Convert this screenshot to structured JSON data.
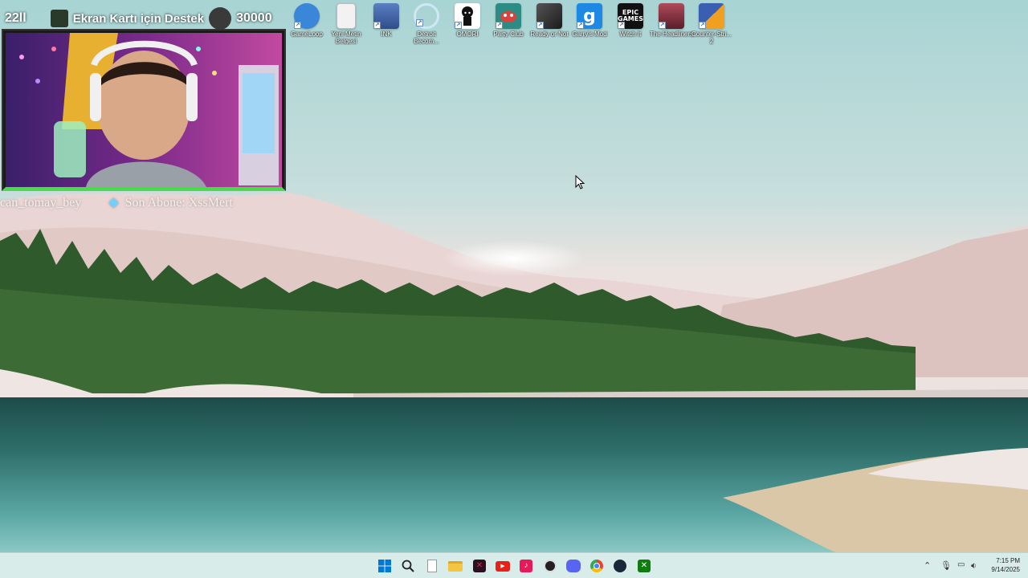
{
  "overlay": {
    "viewer_count": "22ll",
    "banner_text": "Ekran Kartı için Destek",
    "goal": "30000",
    "ticker_left": "can_tomay_bey",
    "ticker_right": "Son Abone: XssMert"
  },
  "desktop_icons": [
    {
      "label": "GameLoop",
      "icon": "gameloop-icon",
      "color": "#3a86d8"
    },
    {
      "label": "Yeni Metin Belgesi",
      "icon": "text-document-icon",
      "color": "#f2f2f2"
    },
    {
      "label": "INK",
      "icon": "ink-game-icon",
      "color": "#2f4d8a"
    },
    {
      "label": "Detroit Becom...",
      "icon": "detroit-icon",
      "color": "#e8f4fb"
    },
    {
      "label": "OMORI",
      "icon": "omori-icon",
      "color": "#ffffff"
    },
    {
      "label": "Party Club",
      "icon": "party-club-icon",
      "color": "#2c8c83"
    },
    {
      "label": "Ready or Not",
      "icon": "ready-or-not-icon",
      "color": "#2b2b2b"
    },
    {
      "label": "Garry's Mod",
      "icon": "garrys-mod-icon",
      "color": "#1e88e5"
    },
    {
      "label": "Witch It",
      "icon": "epic-games-icon",
      "color": "#111111"
    },
    {
      "label": "The Headliners",
      "icon": "headliners-icon",
      "color": "#7a2a3a"
    },
    {
      "label": "Counter-Stri... 2",
      "icon": "counter-strike-icon",
      "color": "#f0a020"
    }
  ],
  "epic_text": "EPIC\nGAMES",
  "garrys_text": "g",
  "taskbar": {
    "apps": [
      {
        "name": "start-button",
        "icon": "windows-icon"
      },
      {
        "name": "search-button",
        "icon": "search-icon"
      },
      {
        "name": "taskbar-notepad",
        "icon": "document-icon"
      },
      {
        "name": "taskbar-file-explorer",
        "icon": "folder-icon"
      },
      {
        "name": "taskbar-app-dark",
        "icon": "app-icon"
      },
      {
        "name": "taskbar-youtube",
        "icon": "youtube-icon"
      },
      {
        "name": "taskbar-tiktok",
        "icon": "tiktok-icon"
      },
      {
        "name": "taskbar-obs",
        "icon": "obs-icon"
      },
      {
        "name": "taskbar-discord",
        "icon": "discord-icon"
      },
      {
        "name": "taskbar-chrome",
        "icon": "chrome-icon"
      },
      {
        "name": "taskbar-steam",
        "icon": "steam-icon"
      },
      {
        "name": "taskbar-xbox",
        "icon": "xbox-icon"
      }
    ],
    "time": "7:15 PM",
    "date": "9/14/2025",
    "accent": "#0078d4"
  }
}
